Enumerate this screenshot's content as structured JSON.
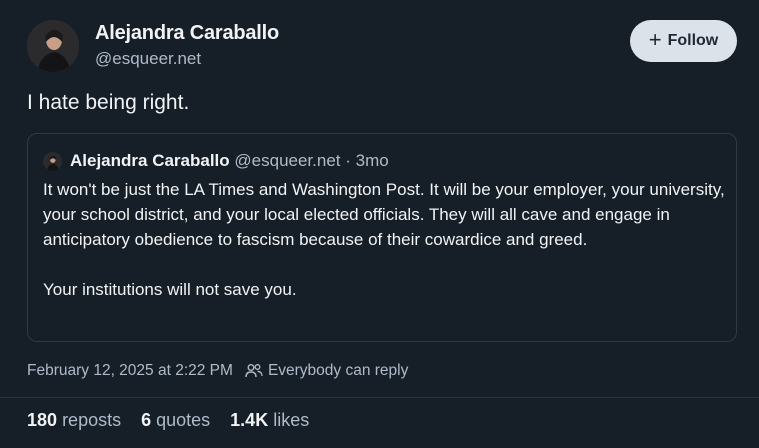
{
  "author": {
    "display_name": "Alejandra Caraballo",
    "handle": "@esqueer.net",
    "avatar_icon": "avatar-portrait"
  },
  "follow_button": {
    "icon": "plus-icon",
    "label": "Follow"
  },
  "post": {
    "text": "I hate being right."
  },
  "quoted_post": {
    "display_name": "Alejandra Caraballo",
    "handle": "@esqueer.net",
    "separator": " · ",
    "age": "3mo",
    "paragraph_1": "It won't be just the LA Times and Washington Post. It will be your employer, your university, your school district, and your local elected officials. They will all cave and engage in anticipatory obedience to fascism because of their cowardice and greed.",
    "paragraph_2": "Your institutions will not save you."
  },
  "meta": {
    "timestamp": "February 12, 2025 at 2:22 PM",
    "reply_setting_icon": "people-icon",
    "reply_setting": "Everybody can reply"
  },
  "stats": {
    "reposts_count": "180",
    "reposts_label": "reposts",
    "quotes_count": "6",
    "quotes_label": "quotes",
    "likes_count": "1.4K",
    "likes_label": "likes"
  },
  "colors": {
    "background": "#161e27",
    "text_primary": "#f1f3f5",
    "text_secondary": "#aebbc9",
    "follow_button_bg": "#dce2ea",
    "border": "#2e3a48"
  }
}
